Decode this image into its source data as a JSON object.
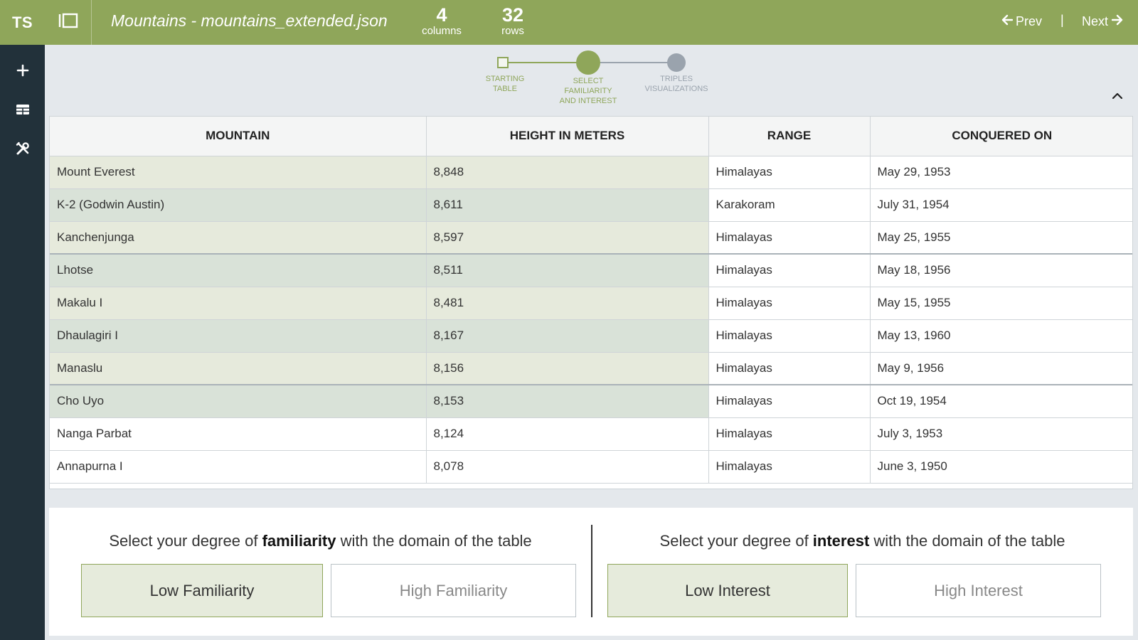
{
  "app": {
    "logo": "TS"
  },
  "sidebar": {
    "items": [
      {
        "icon": "plus-icon"
      },
      {
        "icon": "table-icon"
      },
      {
        "icon": "tools-icon"
      }
    ]
  },
  "header": {
    "title": "Mountains - mountains_extended.json",
    "columns_count": "4",
    "columns_label": "columns",
    "rows_count": "32",
    "rows_label": "rows",
    "prev_label": "Prev",
    "separator": "|",
    "next_label": "Next"
  },
  "stepper": {
    "steps": [
      {
        "line1": "STARTING",
        "line2": "TABLE",
        "line3": "",
        "state": "done"
      },
      {
        "line1": "SELECT",
        "line2": "FAMILIARITY",
        "line3": "AND INTEREST",
        "state": "active"
      },
      {
        "line1": "TRIPLES",
        "line2": "VISUALIZATIONS",
        "line3": "",
        "state": "pending"
      }
    ]
  },
  "table": {
    "headers": [
      "MOUNTAIN",
      "HEIGHT IN METERS",
      "RANGE",
      "CONQUERED ON"
    ],
    "rows": [
      [
        "Mount Everest",
        "8,848",
        "Himalayas",
        "May 29, 1953"
      ],
      [
        "K-2 (Godwin Austin)",
        "8,611",
        "Karakoram",
        "July 31, 1954"
      ],
      [
        "Kanchenjunga",
        "8,597",
        "Himalayas",
        "May 25, 1955"
      ],
      [
        "Lhotse",
        "8,511",
        "Himalayas",
        "May 18, 1956"
      ],
      [
        "Makalu I",
        "8,481",
        "Himalayas",
        "May 15, 1955"
      ],
      [
        "Dhaulagiri I",
        "8,167",
        "Himalayas",
        "May 13, 1960"
      ],
      [
        "Manaslu",
        "8,156",
        "Himalayas",
        "May 9, 1956"
      ],
      [
        "Cho Uyo",
        "8,153",
        "Himalayas",
        "Oct 19, 1954"
      ],
      [
        "Nanga Parbat",
        "8,124",
        "Himalayas",
        "July 3, 1953"
      ],
      [
        "Annapurna I",
        "8,078",
        "Himalayas",
        "June 3, 1950"
      ]
    ]
  },
  "familiarity": {
    "prompt_pre": "Select your degree of ",
    "prompt_bold": "familiarity",
    "prompt_post": " with the domain of the table",
    "low_label": "Low Familiarity",
    "high_label": "High Familiarity",
    "selected": "low"
  },
  "interest": {
    "prompt_pre": "Select your degree of ",
    "prompt_bold": "interest",
    "prompt_post": " with the domain of the table",
    "low_label": "Low Interest",
    "high_label": "High Interest",
    "selected": "low"
  },
  "colors": {
    "accent": "#8fa65a",
    "sidebar": "#22313a",
    "highlight_a": "#e6eadc",
    "highlight_b": "#d9e2d8",
    "pending": "#9aa3ad"
  }
}
